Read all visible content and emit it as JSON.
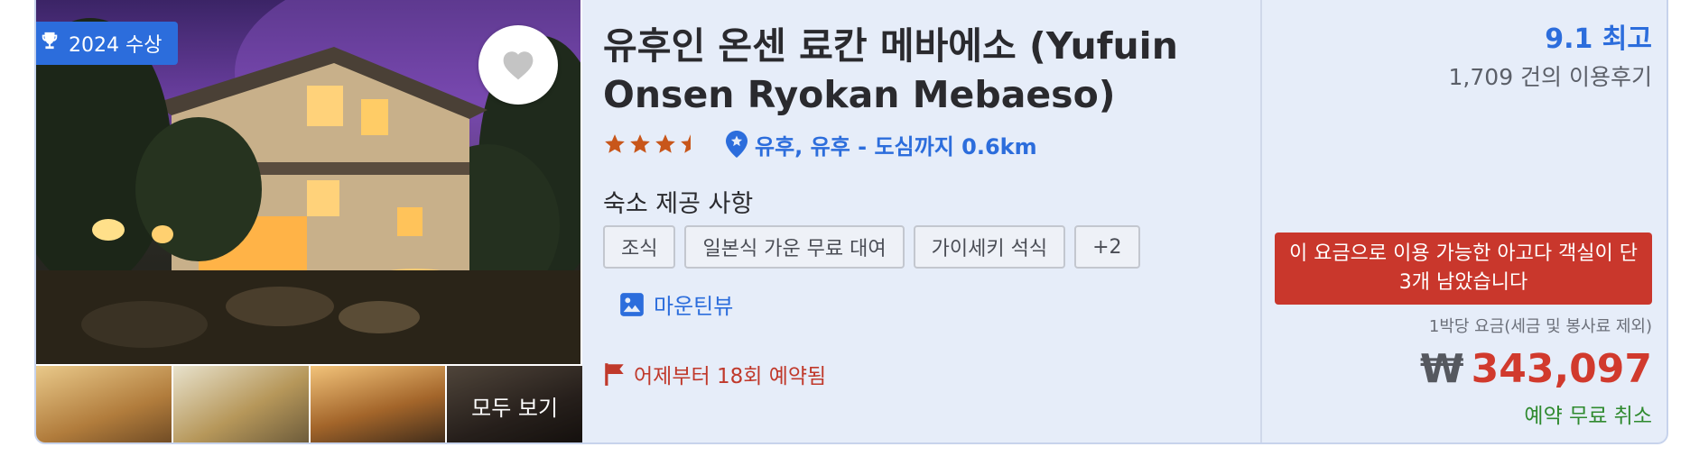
{
  "badge": {
    "label": "2024 수상",
    "icon": "trophy-icon"
  },
  "gallery": {
    "see_all_label": "모두 보기"
  },
  "hotel": {
    "name": "유후인 온센 료칸 메바에소 (Yufuin Onsen Ryokan Mebaeso)",
    "star_rating": 3.5,
    "location": "유후, 유후 - 도심까지 0.6km"
  },
  "amenities": {
    "title": "숙소 제공 사항",
    "items": [
      "조식",
      "일본식 가운 무료 대여",
      "가이세키 석식",
      "+2"
    ]
  },
  "mountain_view_label": "마운틴뷰",
  "booked_label": "어제부터 18회 예약됨",
  "review": {
    "score_text": "9.1 최고",
    "count_text": "1,709 건의 이용후기"
  },
  "alert_text": "이 요금으로 이용 가능한 아고다 객실이 단 3개 남았습니다",
  "price": {
    "per_night_label": "1박당 요금(세금 및 봉사료 제외)",
    "currency": "₩",
    "amount": "343,097",
    "free_cancel_label": "예약 무료 취소"
  },
  "colors": {
    "accent": "#2c6ddc",
    "alert": "#c9372c",
    "price": "#d13a2d",
    "star": "#c8561a",
    "success": "#2f8a2f"
  }
}
